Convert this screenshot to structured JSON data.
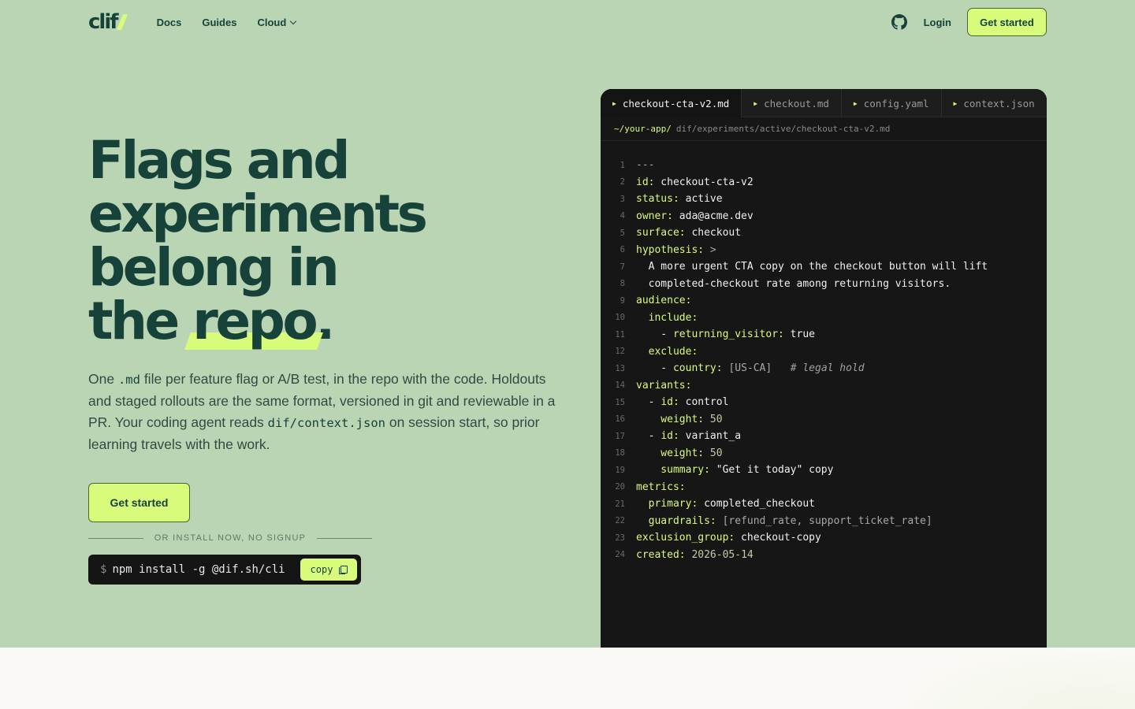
{
  "brand": {
    "logo_text": "clif"
  },
  "nav": {
    "links": [
      {
        "label": "Docs"
      },
      {
        "label": "Guides"
      },
      {
        "label": "Cloud"
      }
    ],
    "login": "Login",
    "cta": "Get started"
  },
  "hero": {
    "headline": {
      "line1": "Flags and",
      "line2": "experiments",
      "line3": "belong in",
      "line4_pre": "the ",
      "line4_highlight": "repo",
      "line4_post": "."
    },
    "desc": {
      "p1": "One ",
      "c1": ".md",
      "p2": " file per feature flag or A/B test, in the repo with the code. Holdouts and staged rollouts are the same format, versioned in git and reviewable in a PR. Your coding agent reads ",
      "c2": "dif/context.json",
      "p3": " on session start, so prior learning travels with the work."
    },
    "cta": "Get started",
    "divider_label": "OR INSTALL NOW, NO SIGNUP",
    "install": {
      "prompt": "$",
      "command": "npm install -g @dif.sh/cli",
      "copy_label": "copy"
    }
  },
  "editor": {
    "tabs": [
      {
        "label": "checkout-cta-v2.md",
        "active": true
      },
      {
        "label": "checkout.md",
        "active": false
      },
      {
        "label": "config.yaml",
        "active": false
      },
      {
        "label": "context.json",
        "active": false
      }
    ],
    "path_root": "~/your-app/",
    "path_rest": "dif/experiments/active/checkout-cta-v2.md",
    "lines": [
      [
        [
          "g",
          "---"
        ]
      ],
      [
        [
          "k",
          "id:"
        ],
        [
          "v",
          " checkout-cta-v2"
        ]
      ],
      [
        [
          "k",
          "status:"
        ],
        [
          "v",
          " active"
        ]
      ],
      [
        [
          "k",
          "owner:"
        ],
        [
          "v",
          " ada@acme.dev"
        ]
      ],
      [
        [
          "k",
          "surface:"
        ],
        [
          "v",
          " checkout"
        ]
      ],
      [
        [
          "k",
          "hypothesis:"
        ],
        [
          "g",
          " >"
        ]
      ],
      [
        [
          "v",
          "  A more urgent CTA copy on the checkout button will lift"
        ]
      ],
      [
        [
          "v",
          "  completed-checkout rate among returning visitors."
        ]
      ],
      [
        [
          "k",
          "audience:"
        ]
      ],
      [
        [
          "k",
          "  include:"
        ]
      ],
      [
        [
          "v",
          "    - "
        ],
        [
          "k",
          "returning_visitor:"
        ],
        [
          "v",
          " true"
        ]
      ],
      [
        [
          "k",
          "  exclude:"
        ]
      ],
      [
        [
          "v",
          "    - "
        ],
        [
          "k",
          "country:"
        ],
        [
          "g",
          " [US-CA]"
        ],
        [
          "c",
          "   # legal hold"
        ]
      ],
      [
        [
          "k",
          "variants:"
        ]
      ],
      [
        [
          "v",
          "  - "
        ],
        [
          "k",
          "id:"
        ],
        [
          "v",
          " control"
        ]
      ],
      [
        [
          "k",
          "    weight:"
        ],
        [
          "n",
          " 50"
        ]
      ],
      [
        [
          "v",
          "  - "
        ],
        [
          "k",
          "id:"
        ],
        [
          "v",
          " variant_a"
        ]
      ],
      [
        [
          "k",
          "    weight:"
        ],
        [
          "n",
          " 50"
        ]
      ],
      [
        [
          "k",
          "    summary:"
        ],
        [
          "v",
          " \"Get it today\" copy"
        ]
      ],
      [
        [
          "k",
          "metrics:"
        ]
      ],
      [
        [
          "k",
          "  primary:"
        ],
        [
          "v",
          " completed_checkout"
        ]
      ],
      [
        [
          "k",
          "  guardrails:"
        ],
        [
          "g",
          " [refund_rate, support_ticket_rate]"
        ]
      ],
      [
        [
          "k",
          "exclusion_group:"
        ],
        [
          "v",
          " checkout-copy"
        ]
      ],
      [
        [
          "k",
          "created:"
        ],
        [
          "n",
          " 2026-05-14"
        ]
      ]
    ]
  }
}
